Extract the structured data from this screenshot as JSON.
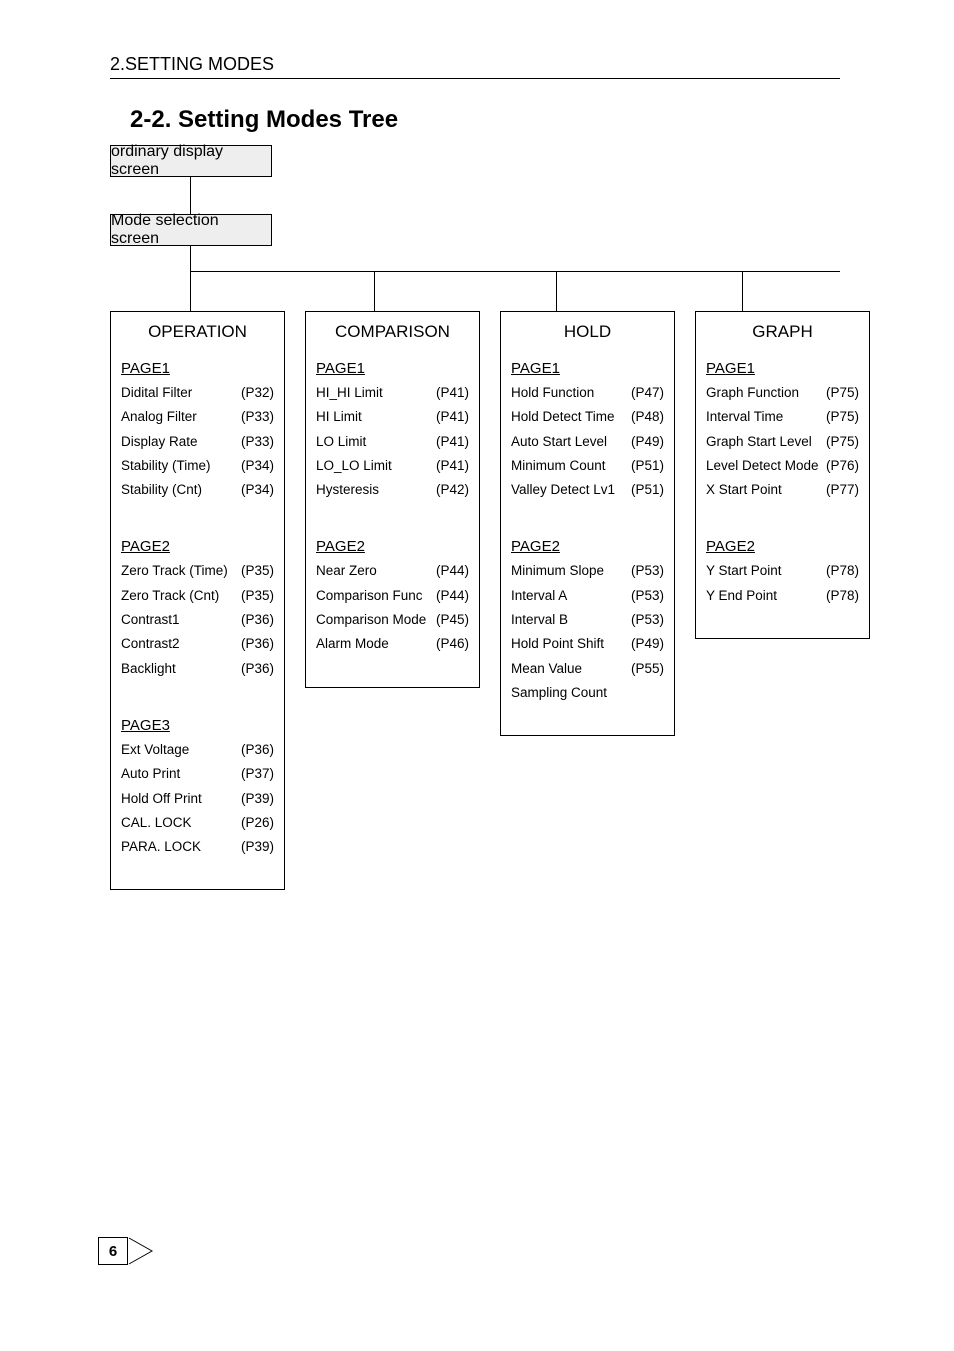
{
  "chapter": "2.SETTING MODES",
  "section_title": "2-2. Setting Modes Tree",
  "ordinary_box": "ordinary display screen",
  "mode_box": "Mode selection screen",
  "page_number": "6",
  "columns": [
    {
      "title": "OPERATION",
      "pages": [
        {
          "label": "PAGE1",
          "rows": [
            {
              "label": "Didital Filter",
              "ref": "(P32)"
            },
            {
              "label": "Analog Filter",
              "ref": "(P33)"
            },
            {
              "label": "Display Rate",
              "ref": "(P33)"
            },
            {
              "label": "Stability (Time)",
              "ref": "(P34)"
            },
            {
              "label": "Stability (Cnt)",
              "ref": "(P34)"
            }
          ]
        },
        {
          "label": "PAGE2",
          "rows": [
            {
              "label": "Zero Track (Time)",
              "ref": "(P35)"
            },
            {
              "label": "Zero Track (Cnt)",
              "ref": "(P35)"
            },
            {
              "label": "Contrast1",
              "ref": "(P36)"
            },
            {
              "label": "Contrast2",
              "ref": "(P36)"
            },
            {
              "label": "Backlight",
              "ref": "(P36)"
            }
          ]
        },
        {
          "label": "PAGE3",
          "rows": [
            {
              "label": "Ext Voltage",
              "ref": "(P36)"
            },
            {
              "label": "Auto Print",
              "ref": "(P37)"
            },
            {
              "label": "Hold Off Print",
              "ref": "(P39)"
            },
            {
              "label": "CAL. LOCK",
              "ref": "(P26)"
            },
            {
              "label": "PARA. LOCK",
              "ref": "(P39)"
            }
          ]
        }
      ]
    },
    {
      "title": "COMPARISON",
      "pages": [
        {
          "label": "PAGE1",
          "rows": [
            {
              "label": "HI_HI Limit",
              "ref": "(P41)"
            },
            {
              "label": "HI Limit",
              "ref": "(P41)"
            },
            {
              "label": "LO Limit",
              "ref": "(P41)"
            },
            {
              "label": "LO_LO Limit",
              "ref": "(P41)"
            },
            {
              "label": "Hysteresis",
              "ref": "(P42)"
            }
          ]
        },
        {
          "label": "PAGE2",
          "rows": [
            {
              "label": "Near Zero",
              "ref": "(P44)"
            },
            {
              "label": "Comparison Func",
              "ref": "(P44)"
            },
            {
              "label": "Comparison Mode",
              "ref": "(P45)"
            },
            {
              "label": "Alarm Mode",
              "ref": "(P46)"
            }
          ]
        }
      ]
    },
    {
      "title": "HOLD",
      "pages": [
        {
          "label": "PAGE1",
          "rows": [
            {
              "label": "Hold Function",
              "ref": "(P47)"
            },
            {
              "label": "Hold Detect Time",
              "ref": "(P48)"
            },
            {
              "label": "Auto Start Level",
              "ref": "(P49)"
            },
            {
              "label": "Minimum Count",
              "ref": "(P51)"
            },
            {
              "label": "Valley Detect Lv1",
              "ref": "(P51)"
            }
          ]
        },
        {
          "label": "PAGE2",
          "rows": [
            {
              "label": "Minimum Slope",
              "ref": "(P53)"
            },
            {
              "label": "Interval A",
              "ref": "(P53)"
            },
            {
              "label": "Interval B",
              "ref": "(P53)"
            },
            {
              "label": "Hold Point Shift",
              "ref": "(P49)"
            },
            {
              "label": "Mean Value Sampling Count",
              "ref": "(P55)"
            }
          ]
        }
      ]
    },
    {
      "title": "GRAPH",
      "pages": [
        {
          "label": "PAGE1",
          "rows": [
            {
              "label": "Graph Function",
              "ref": "(P75)"
            },
            {
              "label": "Interval Time",
              "ref": "(P75)"
            },
            {
              "label": "Graph Start Level",
              "ref": "(P75)"
            },
            {
              "label": "Level Detect Mode",
              "ref": "(P76)"
            },
            {
              "label": "X Start Point",
              "ref": "(P77)"
            }
          ]
        },
        {
          "label": "PAGE2",
          "rows": [
            {
              "label": "Y Start Point",
              "ref": "(P78)"
            },
            {
              "label": "Y End Point",
              "ref": "(P78)"
            }
          ]
        }
      ]
    }
  ],
  "drop_lefts": [
    190,
    374,
    556,
    742
  ]
}
